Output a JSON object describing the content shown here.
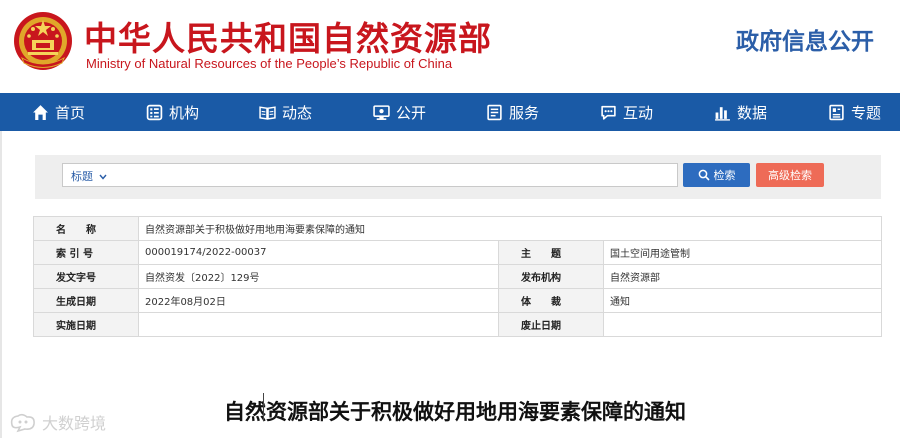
{
  "header": {
    "title_cn": "中华人民共和国自然资源部",
    "title_en": "Ministry of Natural Resources of the People’s Republic of China",
    "gov_info": "政府信息公开"
  },
  "nav": {
    "items": [
      {
        "label": "首页",
        "icon": "home-icon"
      },
      {
        "label": "机构",
        "icon": "organization-icon"
      },
      {
        "label": "动态",
        "icon": "news-icon"
      },
      {
        "label": "公开",
        "icon": "disclosure-icon"
      },
      {
        "label": "服务",
        "icon": "service-icon"
      },
      {
        "label": "互动",
        "icon": "chat-icon"
      },
      {
        "label": "数据",
        "icon": "data-chart-icon"
      },
      {
        "label": "专题",
        "icon": "topic-icon"
      }
    ]
  },
  "search": {
    "field_select": "标题",
    "search_label": "检索",
    "advanced_label": "高级检索"
  },
  "meta": {
    "name_label": "名　　称",
    "name_value": "自然资源部关于积极做好用地用海要素保障的通知",
    "index_label": "索 引 号",
    "index_value": "000019174/2022-00037",
    "subject_label": "主　　题",
    "subject_value": "国土空间用途管制",
    "doc_no_label": "发文字号",
    "doc_no_value": "自然资发〔2022〕129号",
    "publisher_label": "发布机构",
    "publisher_value": "自然资源部",
    "created_label": "生成日期",
    "created_value": "2022年08月02日",
    "genre_label": "体　　裁",
    "genre_value": "通知",
    "effective_label": "实施日期",
    "effective_value": "",
    "expiry_label": "废止日期",
    "expiry_value": ""
  },
  "article": {
    "title": "自然资源部关于积极做好用地用海要素保障的通知"
  },
  "watermark": {
    "text": "大数跨境"
  },
  "colors": {
    "brand_red": "#c8161d",
    "nav_blue": "#1a5aa6",
    "search_blue": "#2d6cbf",
    "advanced_orange": "#ee6b57"
  }
}
